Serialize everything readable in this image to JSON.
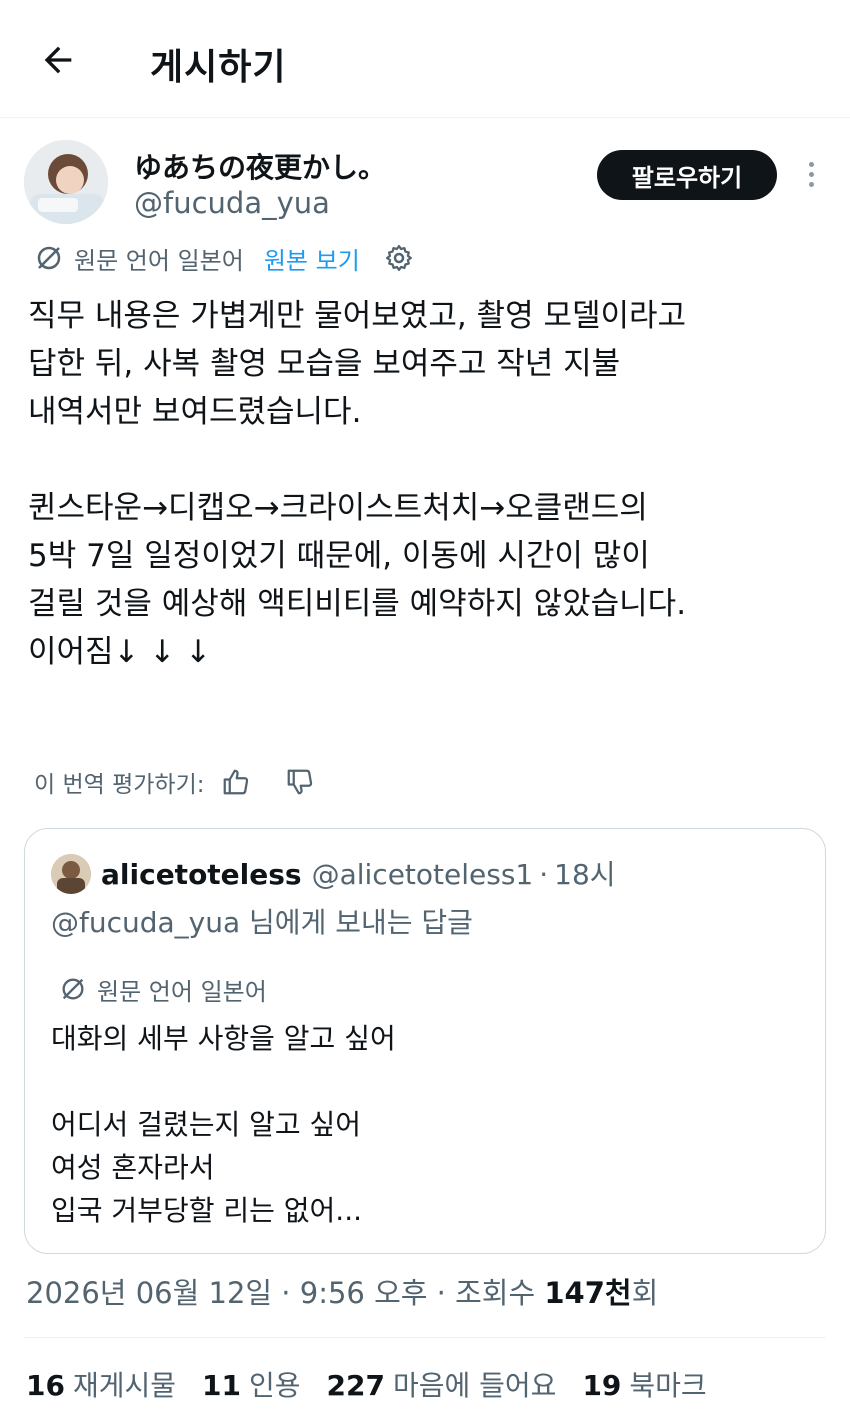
{
  "header": {
    "title": "게시하기",
    "back_icon": "arrow-left-icon"
  },
  "author": {
    "display_name": "ゆあちの夜更かし。",
    "handle": "@fucuda_yua",
    "follow_label": "팔로우하기"
  },
  "translation": {
    "source_label": "원문 언어 일본어",
    "view_original_label": "원본 보기"
  },
  "post": {
    "text": "직무 내용은 가볍게만 물어보였고, 촬영 모델이라고\n답한 뒤, 사복 촬영 모습을 보여주고 작년 지불\n내역서만 보여드렸습니다.\n\n퀸스타운→디캡오→크라이스트처치→오클랜드의\n5박 7일 일정이었기 때문에, 이동에 시간이 많이\n걸릴 것을 예상해 액티비티를 예약하지 않았습니다.\n이어짐↓ ↓ ↓"
  },
  "rate": {
    "label": "이 번역 평가하기:"
  },
  "quote": {
    "name": "alicetoteless",
    "handle": "@alicetoteless1",
    "separator": "·",
    "time": "18시",
    "reply_to": "@fucuda_yua 님에게 보내는 답글",
    "source_label": "원문 언어 일본어",
    "text": "대화의 세부 사항을 알고 싶어\n\n어디서 걸렸는지 알고 싶어\n여성 혼자라서\n입국 거부당할 리는 없어..."
  },
  "meta": {
    "datetime": "2026년 06월 12일 · 9:56 오후 · 조회수 ",
    "views": "147천",
    "views_suffix": "회"
  },
  "stats": [
    {
      "num": "16",
      "label": "재게시물"
    },
    {
      "num": "11",
      "label": "인용"
    },
    {
      "num": "227",
      "label": "마음에 들어요"
    },
    {
      "num": "19",
      "label": "북마크"
    }
  ],
  "colors": {
    "link": "#1d9bf0",
    "secondary": "#536471",
    "primary": "#0f1419"
  }
}
